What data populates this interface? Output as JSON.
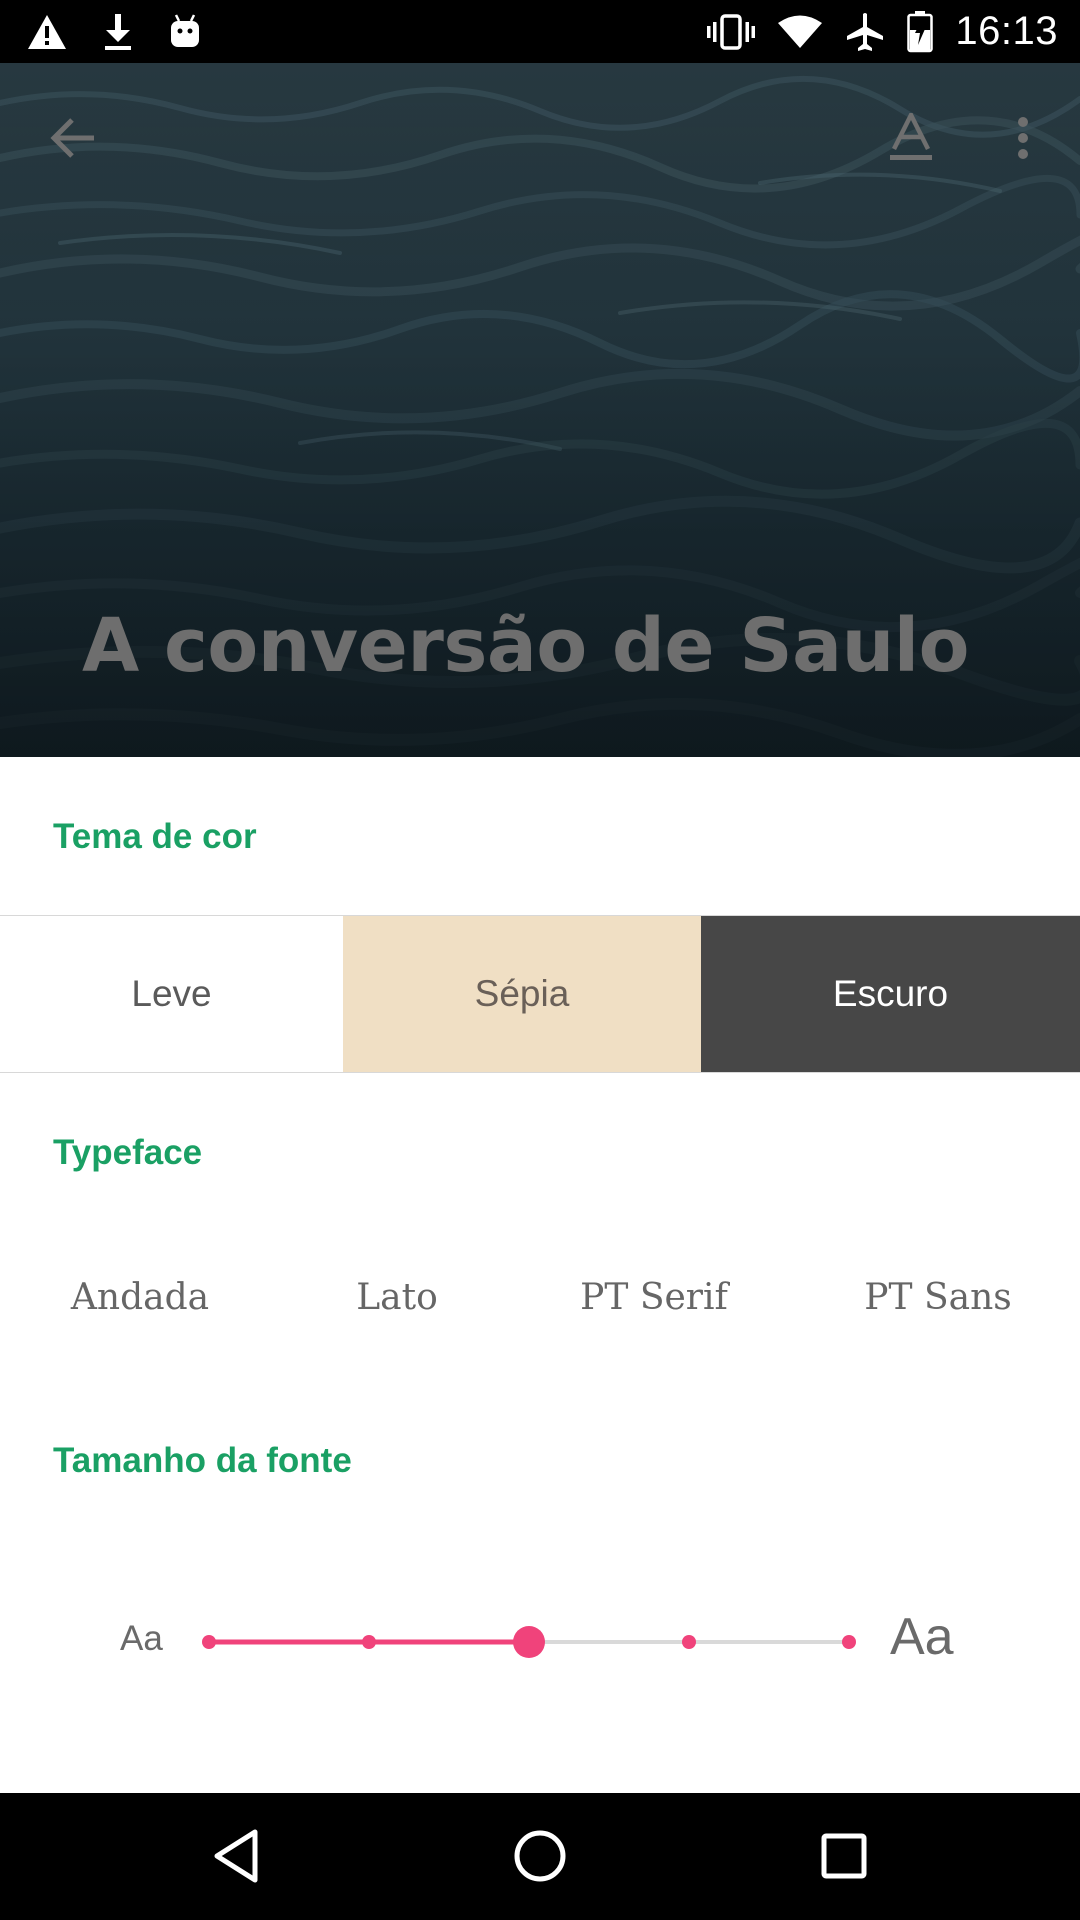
{
  "status_bar": {
    "time": "16:13",
    "left_icons": [
      "warning-icon",
      "download-icon",
      "android-icon"
    ],
    "right_icons": [
      "vibrate-icon",
      "wifi-icon",
      "airplane-icon",
      "battery-icon"
    ]
  },
  "hero": {
    "title": "A conversão de Saulo",
    "actions": [
      "back-arrow-icon",
      "text-format-icon",
      "more-vert-icon"
    ]
  },
  "sections": {
    "theme_label": "Tema de cor",
    "typeface_label": "Typeface",
    "font_size_label": "Tamanho da fonte"
  },
  "themes": [
    {
      "label": "Leve",
      "color": "#ffffff"
    },
    {
      "label": "Sépia",
      "color": "#f0dfc4"
    },
    {
      "label": "Escuro",
      "color": "#474747"
    }
  ],
  "typefaces": [
    "Andada",
    "Lato",
    "PT Serif",
    "PT Sans"
  ],
  "font_size": {
    "small_label": "Aa",
    "large_label": "Aa",
    "steps": 5,
    "selected_step": 3
  },
  "colors": {
    "accent_green": "#1aa064",
    "slider_pink": "#f0437b",
    "slider_track": "#d9d9d9"
  },
  "nav_bar": [
    "nav-back-icon",
    "nav-home-icon",
    "nav-recents-icon"
  ]
}
